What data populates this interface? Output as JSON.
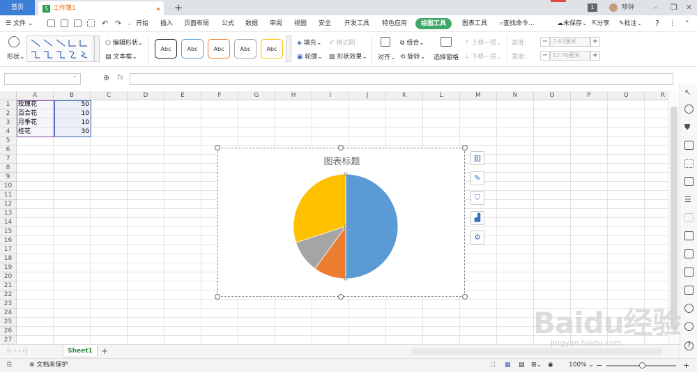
{
  "tabs": {
    "home": "首页",
    "doc_title": "工作簿1",
    "new_tab": "+"
  },
  "titlebar": {
    "badge": "1",
    "user": "哆钟"
  },
  "menu": {
    "items": [
      "文件",
      "开始",
      "插入",
      "页面布局",
      "公式",
      "数据",
      "审阅",
      "视图",
      "安全",
      "开发工具",
      "特色应用",
      "绘图工具",
      "图表工具"
    ],
    "active": "绘图工具",
    "search": "查找命令...",
    "unsaved": "未保存",
    "share": "分享",
    "comment": "批注"
  },
  "ribbon": {
    "shape": "形状",
    "edit_shape": "编辑形状",
    "textbox": "文本框",
    "styles": [
      "Abc",
      "Abc",
      "Abc",
      "Abc",
      "Abc"
    ],
    "style_colors": [
      "#222222",
      "#5b9bd5",
      "#ed7d31",
      "#a5a5a5",
      "#ffc000"
    ],
    "fill": "填充",
    "format_brush": "格式刷",
    "outline": "轮廓",
    "shape_effect": "形状效果",
    "align": "对齐",
    "group": "组合",
    "rotate": "旋转",
    "selection_pane": "选择窗格",
    "bring_forward": "上移一层",
    "send_backward": "下移一层",
    "height_label": "高度:",
    "height_value": "7.62厘米",
    "width_label": "宽度:",
    "width_value": "12.70厘米"
  },
  "formula": {
    "fx": "fx"
  },
  "columns": [
    "A",
    "B",
    "C",
    "D",
    "E",
    "F",
    "G",
    "H",
    "I",
    "J",
    "K",
    "L",
    "M",
    "N",
    "O",
    "P",
    "Q",
    "R"
  ],
  "rows": [
    "1",
    "2",
    "3",
    "4",
    "5",
    "6",
    "7",
    "8",
    "9",
    "10",
    "11",
    "12",
    "13",
    "14",
    "15",
    "16",
    "17",
    "18",
    "19",
    "20",
    "21",
    "22",
    "23",
    "24",
    "25",
    "26",
    "27"
  ],
  "table": [
    {
      "name": "玫瑰花",
      "value": "50"
    },
    {
      "name": "百合花",
      "value": "10"
    },
    {
      "name": "月季花",
      "value": "10"
    },
    {
      "name": "桂花",
      "value": "30"
    }
  ],
  "chart_data": {
    "type": "pie",
    "title": "图表标题",
    "categories": [
      "玫瑰花",
      "百合花",
      "月季花",
      "桂花"
    ],
    "values": [
      50,
      10,
      10,
      30
    ],
    "colors": [
      "#5b9bd5",
      "#ed7d31",
      "#a5a5a5",
      "#ffc000"
    ],
    "legend": "none"
  },
  "sheet": {
    "tab": "Sheet1",
    "add": "+"
  },
  "status": {
    "protect": "文档未保护",
    "zoom": "100%"
  },
  "watermark": {
    "main": "Baidu经验",
    "sub": "jingyan.baidu.com"
  }
}
